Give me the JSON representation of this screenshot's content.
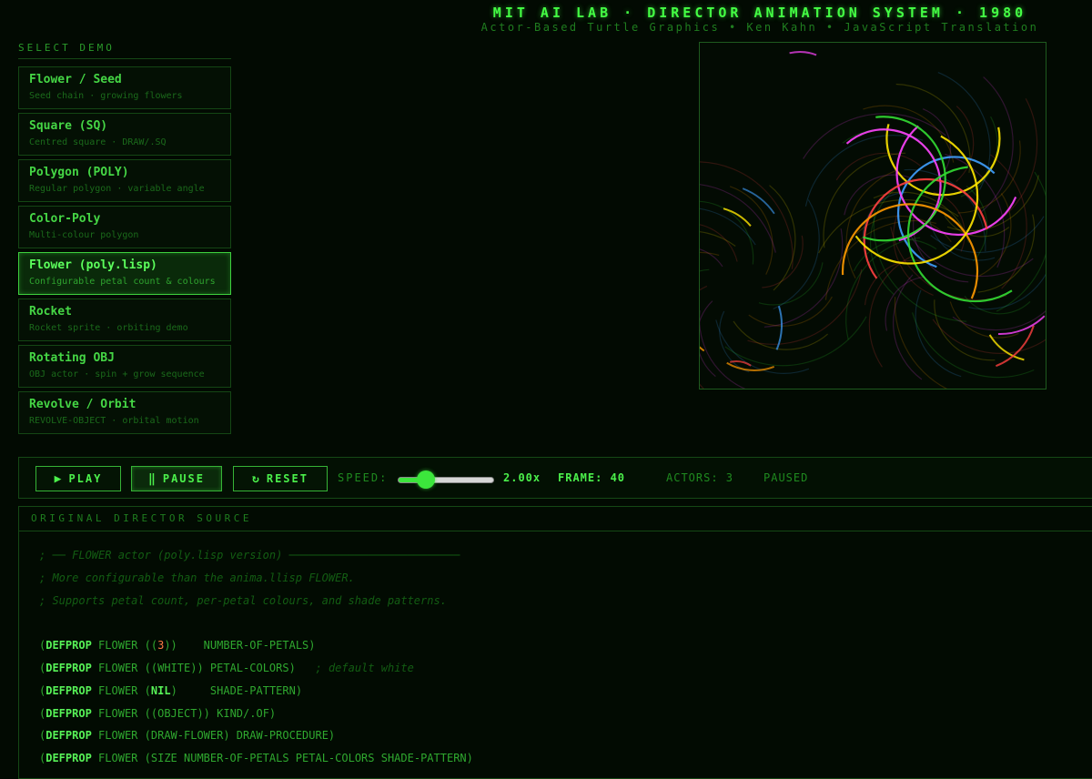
{
  "header": {
    "title": "MIT AI LAB · DIRECTOR ANIMATION SYSTEM · 1980",
    "subtitle": "Actor-Based Turtle Graphics  •  Ken Kahn  •  JavaScript Translation"
  },
  "sidebar": {
    "label": "SELECT DEMO",
    "items": [
      {
        "name": "Flower / Seed",
        "desc": "Seed chain · growing flowers"
      },
      {
        "name": "Square (SQ)",
        "desc": "Centred square · DRAW/.SQ"
      },
      {
        "name": "Polygon (POLY)",
        "desc": "Regular polygon · variable angle"
      },
      {
        "name": "Color-Poly",
        "desc": "Multi-colour polygon"
      },
      {
        "name": "Flower (poly.lisp)",
        "desc": "Configurable petal count & colours"
      },
      {
        "name": "Rocket",
        "desc": "Rocket sprite · orbiting demo"
      },
      {
        "name": "Rotating OBJ",
        "desc": "OBJ actor · spin + grow sequence"
      },
      {
        "name": "Revolve / Orbit",
        "desc": "REVOLVE-OBJECT · orbital motion"
      }
    ],
    "active_index": 4
  },
  "controls": {
    "play": "PLAY",
    "pause": "PAUSE",
    "reset": "RESET",
    "speed_label": "SPEED:",
    "speed_value": "2.00x",
    "speed_fraction": 0.2,
    "frame_label": "FRAME: 40",
    "actors_label": "ACTORS: 3",
    "status": "PAUSED"
  },
  "source": {
    "title": "ORIGINAL DIRECTOR SOURCE",
    "comments": [
      "; ── FLOWER actor (poly.lisp version) ──────────────────────────",
      "; More configurable than the anima.llisp FLOWER.",
      "; Supports petal count, per-petal colours, and shade patterns."
    ],
    "defprop": [
      {
        "kw": "DEFPROP",
        "obj": "FLOWER",
        "pre": "((",
        "num": "3",
        "post": "))",
        "prop": "    NUMBER-OF-PETALS)",
        "comment": ""
      },
      {
        "kw": "DEFPROP",
        "obj": "FLOWER",
        "pre": "((WHITE))",
        "num": "",
        "post": "",
        "prop": " PETAL-COLORS)",
        "comment": "   ; default white"
      },
      {
        "kw": "DEFPROP",
        "obj": "FLOWER",
        "pre": "(",
        "num": "",
        "post": ")",
        "nil": "NIL",
        "prop": "     SHADE-PATTERN)",
        "comment": ""
      },
      {
        "kw": "DEFPROP",
        "obj": "FLOWER",
        "pre": "((OBJECT))",
        "num": "",
        "post": "",
        "prop": " KIND/.OF)",
        "comment": ""
      },
      {
        "kw": "DEFPROP",
        "obj": "FLOWER",
        "pre": "(DRAW-FLOWER)",
        "num": "",
        "post": "",
        "prop": " DRAW-PROCEDURE)",
        "comment": ""
      },
      {
        "kw": "DEFPROP",
        "obj": "FLOWER",
        "pre": "(SIZE NUMBER-OF-PETALS PETAL-COLORS SHADE-PATTERN)",
        "num": "",
        "post": "",
        "prop": "",
        "comment": ""
      }
    ]
  },
  "canvas": {
    "petal_colors": [
      "#ffe600",
      "#3fa0ff",
      "#ff44ff",
      "#ff4040",
      "#33dd33",
      "#ff9900"
    ]
  }
}
